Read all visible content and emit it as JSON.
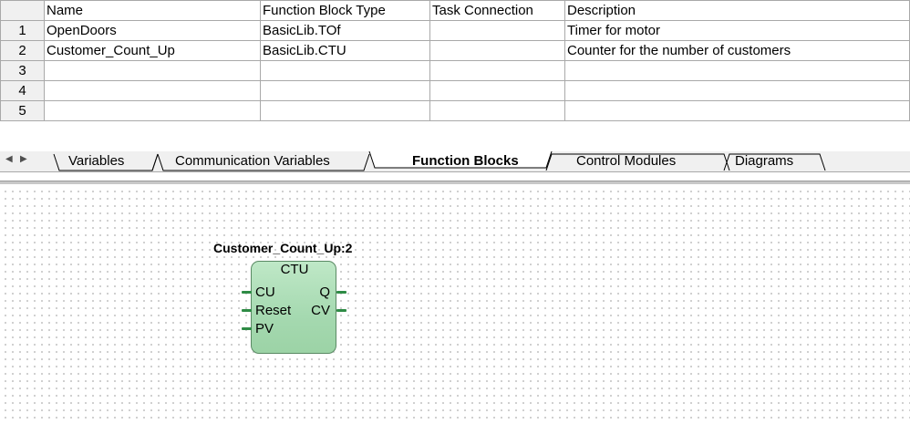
{
  "table": {
    "headers": [
      "Name",
      "Function Block Type",
      "Task Connection",
      "Description"
    ],
    "rows": [
      {
        "num": "1",
        "name": "OpenDoors",
        "type": "BasicLib.TOf",
        "task": "",
        "desc": "Timer for motor"
      },
      {
        "num": "2",
        "name": "Customer_Count_Up",
        "type": "BasicLib.CTU",
        "task": "",
        "desc": "Counter for the number of customers"
      },
      {
        "num": "3",
        "name": "",
        "type": "",
        "task": "",
        "desc": ""
      },
      {
        "num": "4",
        "name": "",
        "type": "",
        "task": "",
        "desc": ""
      },
      {
        "num": "5",
        "name": "",
        "type": "",
        "task": "",
        "desc": ""
      }
    ]
  },
  "tabs": {
    "scroll_left_icon": "triangle-left",
    "scroll_right_icon": "triangle-right",
    "items": [
      "Variables",
      "Communication Variables",
      "Function Blocks",
      "Control Modules",
      "Diagrams"
    ],
    "active": "Function Blocks"
  },
  "diagram": {
    "instance_label": "Customer_Count_Up:2",
    "block_type": "CTU",
    "inputs": [
      "CU",
      "Reset",
      "PV"
    ],
    "outputs": [
      "Q",
      "CV"
    ],
    "block_color": "#a5d9b0",
    "pin_color": "#2e8b45"
  }
}
